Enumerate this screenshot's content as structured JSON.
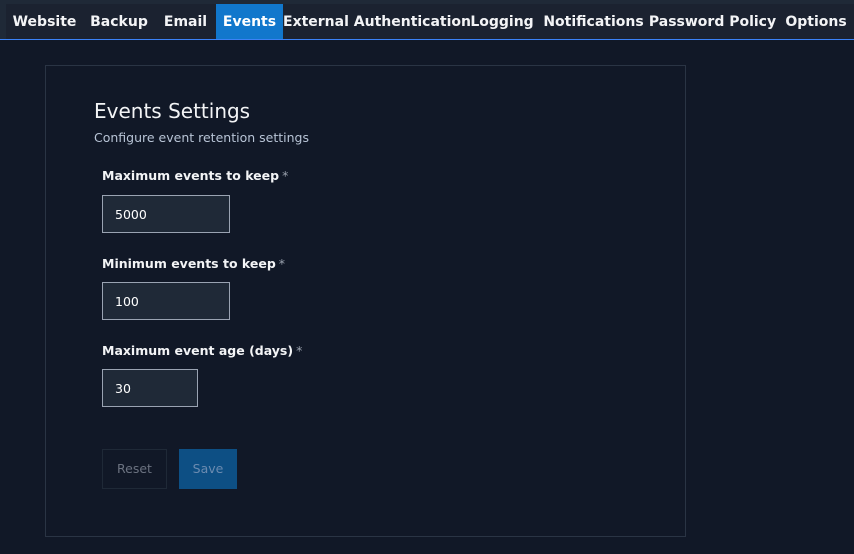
{
  "tabs": [
    {
      "label": "Website",
      "active": false
    },
    {
      "label": "Backup",
      "active": false
    },
    {
      "label": "Email",
      "active": false
    },
    {
      "label": "Events",
      "active": true
    },
    {
      "label": "External Authentication",
      "active": false
    },
    {
      "label": "Logging",
      "active": false
    },
    {
      "label": "Notifications",
      "active": false
    },
    {
      "label": "Password Policy",
      "active": false
    },
    {
      "label": "Options",
      "active": false
    }
  ],
  "card": {
    "title": "Events Settings",
    "subtitle": "Configure event retention settings"
  },
  "fields": [
    {
      "label": "Maximum events to keep",
      "required": "*",
      "value": "5000"
    },
    {
      "label": "Minimum events to keep",
      "required": "*",
      "value": "100"
    },
    {
      "label": "Maximum event age (days)",
      "required": "*",
      "value": "30"
    }
  ],
  "buttons": {
    "reset_label": "Reset",
    "save_label": "Save"
  },
  "colors": {
    "background": "#111827",
    "tabbar": "#1b2230",
    "active_tab": "#1177cc",
    "save_button": "#0d4f84"
  }
}
